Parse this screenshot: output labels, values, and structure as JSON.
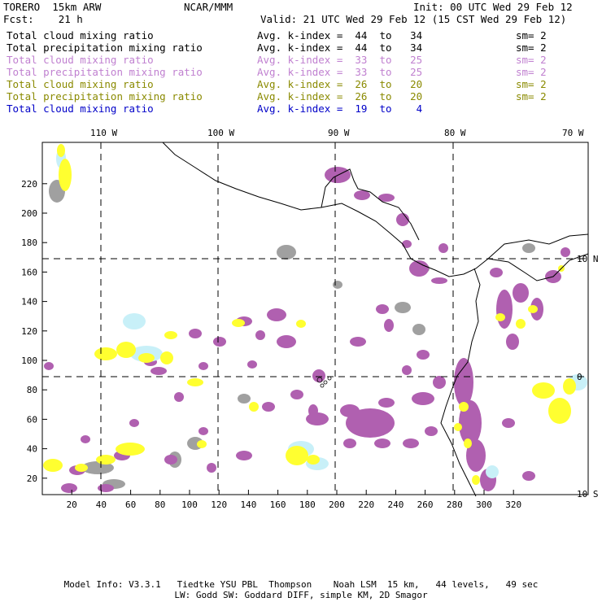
{
  "header": {
    "model": "TORERO  15km ARW",
    "org": "NCAR/MMM",
    "init": "Init: 00 UTC Wed 29 Feb 12",
    "fcst": "Fcst:    21 h",
    "valid": "Valid: 21 UTC Wed 29 Feb 12 (15 CST Wed 29 Feb 12)"
  },
  "legend": [
    {
      "field": "Total cloud mixing ratio",
      "kindex": "Avg. k-index =  44  to   34",
      "sm": "sm= 2",
      "color": "#000000"
    },
    {
      "field": "Total precipitation mixing ratio",
      "kindex": "Avg. k-index =  44  to   34",
      "sm": "sm= 2",
      "color": "#000000"
    },
    {
      "field": "Total cloud mixing ratio",
      "kindex": "Avg. k-index =  33  to   25",
      "sm": "sm= 2",
      "color": "#c080d0"
    },
    {
      "field": "Total precipitation mixing ratio",
      "kindex": "Avg. k-index =  33  to   25",
      "sm": "sm= 2",
      "color": "#c080d0"
    },
    {
      "field": "Total cloud mixing ratio",
      "kindex": "Avg. k-index =  26  to   20",
      "sm": "sm= 2",
      "color": "#8a8a00"
    },
    {
      "field": "Total precipitation mixing ratio",
      "kindex": "Avg. k-index =  26  to   20",
      "sm": "sm= 2",
      "color": "#8a8a00"
    },
    {
      "field": "Total cloud mixing ratio",
      "kindex": "Avg. k-index =  19  to    4",
      "sm": "",
      "color": "#0000c8"
    }
  ],
  "map": {
    "lon_labels": [
      "110 W",
      "100 W",
      "90 W",
      "80 W",
      "70 W"
    ],
    "lat_labels": [
      "10 N",
      "0",
      "10 S"
    ],
    "x_ticks": [
      "20",
      "40",
      "60",
      "80",
      "100",
      "120",
      "140",
      "160",
      "180",
      "200",
      "220",
      "240",
      "260",
      "280",
      "300",
      "320"
    ],
    "y_ticks": [
      "20",
      "40",
      "60",
      "80",
      "100",
      "120",
      "140",
      "160",
      "180",
      "200",
      "220"
    ],
    "colors": {
      "purple": "#b060b0",
      "gray": "#a0a0a0",
      "yellow": "#ffff30",
      "lightblue": "#c8f0f8"
    }
  },
  "footer": {
    "line1": "Model Info: V3.3.1   Tiedtke YSU PBL  Thompson    Noah LSM  15 km,   44 levels,   49 sec",
    "line2": "LW: Godd SW: Goddard DIFF, simple KM, 2D Smagor"
  }
}
